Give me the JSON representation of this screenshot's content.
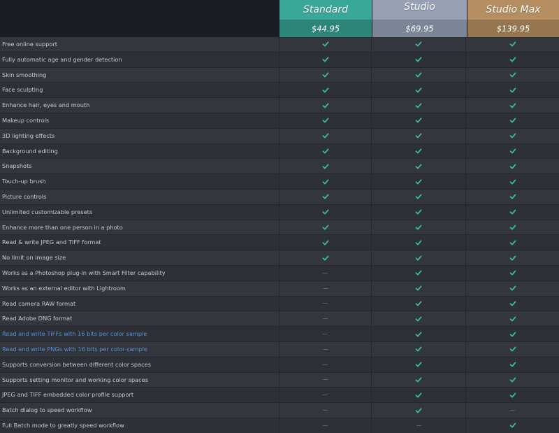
{
  "plans": [
    {
      "name": "Standard",
      "price": "$44.95"
    },
    {
      "name": "Studio",
      "price": "$69.95"
    },
    {
      "name": "Studio Max",
      "price": "$139.95"
    }
  ],
  "colors": {
    "standard": "#3aa898",
    "studio": "#98a0b6",
    "studio_max": "#b58f62",
    "check": "#3fb8a2",
    "link": "#5b8fd6"
  },
  "features": [
    {
      "label": "Free online support",
      "link": false,
      "availability": [
        true,
        true,
        true
      ]
    },
    {
      "label": "Fully automatic age and gender detection",
      "link": false,
      "availability": [
        true,
        true,
        true
      ]
    },
    {
      "label": "Skin smoothing",
      "link": false,
      "availability": [
        true,
        true,
        true
      ]
    },
    {
      "label": "Face sculpting",
      "link": false,
      "availability": [
        true,
        true,
        true
      ]
    },
    {
      "label": "Enhance hair, eyes and mouth",
      "link": false,
      "availability": [
        true,
        true,
        true
      ]
    },
    {
      "label": "Makeup controls",
      "link": false,
      "availability": [
        true,
        true,
        true
      ]
    },
    {
      "label": "3D lighting effects",
      "link": false,
      "availability": [
        true,
        true,
        true
      ]
    },
    {
      "label": "Background editing",
      "link": false,
      "availability": [
        true,
        true,
        true
      ]
    },
    {
      "label": "Snapshots",
      "link": false,
      "availability": [
        true,
        true,
        true
      ]
    },
    {
      "label": "Touch-up brush",
      "link": false,
      "availability": [
        true,
        true,
        true
      ]
    },
    {
      "label": "Picture controls",
      "link": false,
      "availability": [
        true,
        true,
        true
      ]
    },
    {
      "label": "Unlimited customizable presets",
      "link": false,
      "availability": [
        true,
        true,
        true
      ]
    },
    {
      "label": "Enhance more than one person in a photo",
      "link": false,
      "availability": [
        true,
        true,
        true
      ]
    },
    {
      "label": "Read & write JPEG and TIFF format",
      "link": false,
      "availability": [
        true,
        true,
        true
      ]
    },
    {
      "label": "No limit on image size",
      "link": false,
      "availability": [
        true,
        true,
        true
      ]
    },
    {
      "label": "Works as a Photoshop plug-in with Smart Filter capability",
      "link": false,
      "availability": [
        false,
        true,
        true
      ]
    },
    {
      "label": "Works as an external editor with Lightroom",
      "link": false,
      "availability": [
        false,
        true,
        true
      ]
    },
    {
      "label": "Read camera RAW format",
      "link": false,
      "availability": [
        false,
        true,
        true
      ]
    },
    {
      "label": "Read Adobe DNG format",
      "link": false,
      "availability": [
        false,
        true,
        true
      ]
    },
    {
      "label": "Read and write TIFFs with 16 bits per color sample",
      "link": true,
      "availability": [
        false,
        true,
        true
      ]
    },
    {
      "label": "Read and write PNGs with 16 bits per color sample",
      "link": true,
      "availability": [
        false,
        true,
        true
      ]
    },
    {
      "label": "Supports conversion between different color spaces",
      "link": false,
      "availability": [
        false,
        true,
        true
      ]
    },
    {
      "label": "Supports setting monitor and working color spaces",
      "link": false,
      "availability": [
        false,
        true,
        true
      ]
    },
    {
      "label": "JPEG and TIFF embedded color profile support",
      "link": false,
      "availability": [
        false,
        true,
        true
      ]
    },
    {
      "label": "Batch dialog to speed workflow",
      "link": false,
      "availability": [
        false,
        true,
        false
      ]
    },
    {
      "label": "Full Batch mode to greatly speed workflow",
      "link": false,
      "availability": [
        false,
        false,
        true
      ]
    }
  ]
}
